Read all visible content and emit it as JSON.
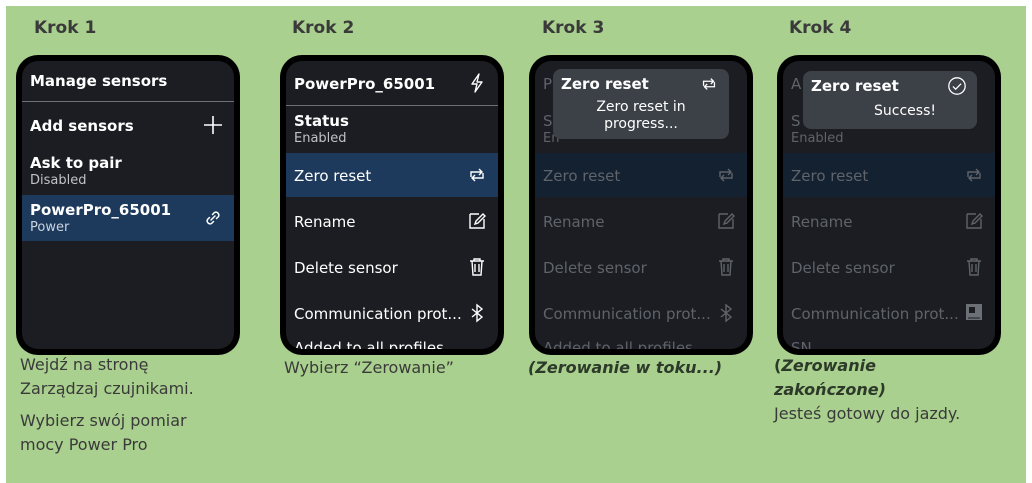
{
  "steps": [
    {
      "title": "Krok 1"
    },
    {
      "title": "Krok 2"
    },
    {
      "title": "Krok 3"
    },
    {
      "title": "Krok 4"
    }
  ],
  "screen1": {
    "header": "Manage sensors",
    "add_sensors": "Add sensors",
    "ask_to_pair": {
      "title": "Ask to pair",
      "sub": "Disabled"
    },
    "sensor": {
      "title": "PowerPro_65001",
      "sub": "Power"
    }
  },
  "screen2": {
    "header": "PowerPro_65001",
    "status": {
      "title": "Status",
      "sub": "Enabled"
    },
    "zero_reset": "Zero reset",
    "rename": "Rename",
    "delete": "Delete sensor",
    "comm": "Communication prot...",
    "added": "Added to all profiles"
  },
  "screen3": {
    "bg_header_frag": "P",
    "bg_status_frag": "S",
    "bg_enabled_frag": "En",
    "zero_reset": "Zero reset",
    "rename": "Rename",
    "delete": "Delete sensor",
    "comm": "Communication prot...",
    "added": "Added to all profiles",
    "popup": {
      "title": "Zero reset",
      "line1": "Zero reset in",
      "line2": "progress..."
    }
  },
  "screen4": {
    "bg_header_frag": "A",
    "bg_status_frag": "S",
    "bg_enabled": "Enabled",
    "zero_reset": "Zero reset",
    "rename": "Rename",
    "delete": "Delete sensor",
    "comm": "Communication prot...",
    "sn": "SN",
    "popup": {
      "title": "Zero reset",
      "message": "Success!"
    }
  },
  "captions": {
    "c1_line1": "Wejdź na stronę",
    "c1_line2": "Zarządzaj czujnikami.",
    "c1_line3": "Wybierz swój pomiar",
    "c1_line4": "mocy Power Pro",
    "c2": "Wybierz “Zerowanie”",
    "c3": "(Zerowanie w toku...)",
    "c4_line1_open": "(",
    "c4_line1": "Zerowanie",
    "c4_line2": "zakończone)",
    "c4_line3": "Jesteś gotowy do jazdy."
  },
  "icons": [
    "plus-icon",
    "link-icon",
    "lightning-icon",
    "refresh-icon",
    "edit-icon",
    "trash-icon",
    "bluetooth-icon",
    "check-circle-icon",
    "sensor-module-icon"
  ],
  "colors": {
    "background": "#a9d08e",
    "screen": "#1b1d22",
    "selected": "#1d3a5c",
    "popup": "#3c4148"
  }
}
